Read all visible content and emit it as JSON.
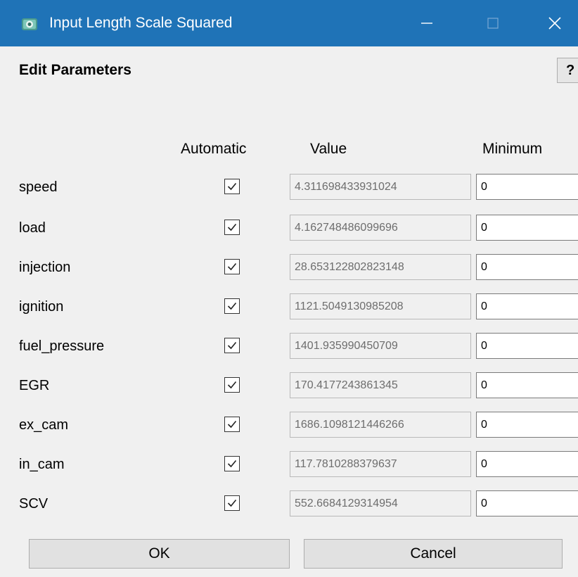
{
  "window": {
    "title": "Input Length Scale Squared",
    "icon": "app-icon",
    "controls": {
      "minimize": "minimize-icon",
      "maximize": "maximize-icon",
      "close": "close-icon"
    }
  },
  "header": {
    "title": "Edit Parameters",
    "help_label": "?"
  },
  "columns": {
    "automatic": "Automatic",
    "value": "Value",
    "minimum": "Minimum"
  },
  "parameters": [
    {
      "name": "speed",
      "automatic": true,
      "value": "4.311698433931024",
      "minimum": "0"
    },
    {
      "name": "load",
      "automatic": true,
      "value": "4.162748486099696",
      "minimum": "0"
    },
    {
      "name": "injection",
      "automatic": true,
      "value": "28.653122802823148",
      "minimum": "0"
    },
    {
      "name": "ignition",
      "automatic": true,
      "value": "1121.5049130985208",
      "minimum": "0"
    },
    {
      "name": "fuel_pressure",
      "automatic": true,
      "value": "1401.935990450709",
      "minimum": "0"
    },
    {
      "name": "EGR",
      "automatic": true,
      "value": "170.4177243861345",
      "minimum": "0"
    },
    {
      "name": "ex_cam",
      "automatic": true,
      "value": "1686.1098121446266",
      "minimum": "0"
    },
    {
      "name": "in_cam",
      "automatic": true,
      "value": "117.7810288379637",
      "minimum": "0"
    },
    {
      "name": "SCV",
      "automatic": true,
      "value": "552.6684129314954",
      "minimum": "0"
    }
  ],
  "buttons": {
    "ok": "OK",
    "cancel": "Cancel"
  },
  "colors": {
    "titlebar": "#1f73b7",
    "window_bg": "#f0f0f0"
  }
}
